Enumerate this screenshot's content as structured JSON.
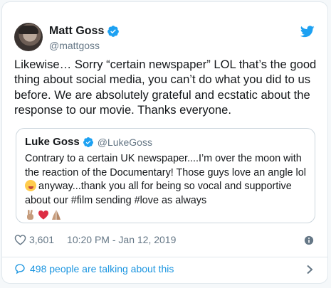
{
  "author": {
    "name": "Matt Goss",
    "handle": "@mattgoss"
  },
  "tweet": {
    "text": "Likewise… Sorry “certain newspaper” LOL that’s the good thing about social media, you can’t do what you did to us before. We are absolutely grateful and ecstatic about the response to our movie. Thanks everyone."
  },
  "quoted": {
    "name": "Luke Goss",
    "handle": "@LukeGoss",
    "text_before_emoji": "Contrary to a certain UK newspaper....I’m over the moon with the reaction of the Documentary! Those guys love an angle lol",
    "text_after_emoji": "anyway...thank you all for being so vocal and supportive about our #film sending #love as always",
    "emojis": [
      "victory-hand",
      "red-heart",
      "folded-hands"
    ]
  },
  "meta": {
    "likes": "3,601",
    "timestamp": "10:20 PM - Jan 12, 2019"
  },
  "footer": {
    "talking": "498 people are talking about this"
  },
  "colors": {
    "accent": "#1b95e0",
    "verified": "#1da1f2",
    "secondary_text": "#657786",
    "border": "#e1e8ed"
  },
  "icons": [
    "verified-badge-icon",
    "twitter-bird-icon",
    "heart-icon",
    "info-icon",
    "comment-bubble-icon",
    "chevron-right-icon"
  ]
}
